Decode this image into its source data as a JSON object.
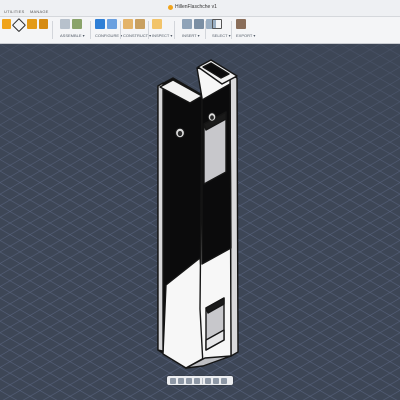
{
  "window": {
    "doc_title": "HillenFlaschche v1"
  },
  "tabs": [
    {
      "label": "UTILITIES"
    },
    {
      "label": "MANAGE"
    }
  ],
  "toolbar_groups": [
    {
      "label": "ASSEMBLE ▾"
    },
    {
      "label": "CONFIGURE ▾"
    },
    {
      "label": "CONSTRUCT ▾"
    },
    {
      "label": "INSPECT ▾"
    },
    {
      "label": "INSERT ▾"
    },
    {
      "label": "SELECT ▾"
    },
    {
      "label": "EXPORT ▾"
    }
  ],
  "colors": {
    "viewport_bg": "#3d4656",
    "grid_line": "#55607a",
    "toolbar_bg": "#f4f5f7",
    "model_black": "#0b0b0c",
    "model_white": "#f7f7f7",
    "model_grey": "#c7c7cb",
    "accent_orange": "#f0a41c",
    "accent_blue": "#2f7fd6"
  },
  "viewport": {
    "grid": true,
    "view": "isometric",
    "model": "vertical bracket with slot and mounting hole"
  },
  "navigation_bar": {
    "tools": [
      "orbit-icon",
      "pan-icon",
      "zoom-icon",
      "fit-icon",
      "display-settings-icon",
      "grid-settings-icon",
      "viewports-icon"
    ]
  }
}
